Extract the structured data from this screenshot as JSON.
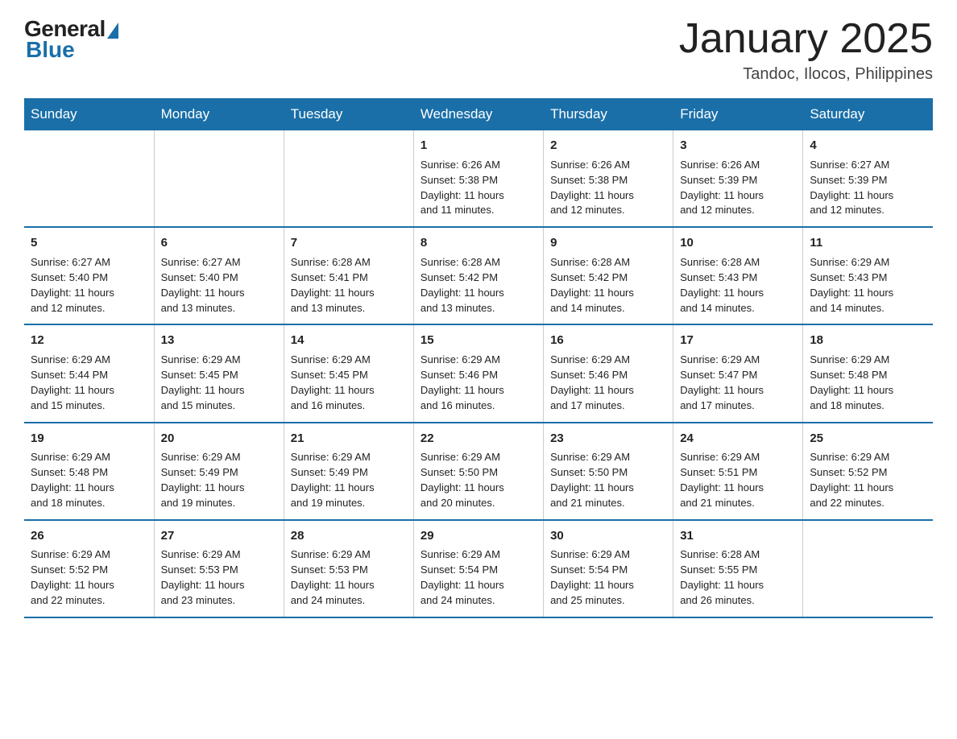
{
  "logo": {
    "general": "General",
    "blue": "Blue"
  },
  "header": {
    "title": "January 2025",
    "subtitle": "Tandoc, Ilocos, Philippines"
  },
  "weekdays": [
    "Sunday",
    "Monday",
    "Tuesday",
    "Wednesday",
    "Thursday",
    "Friday",
    "Saturday"
  ],
  "weeks": [
    [
      {
        "day": "",
        "info": ""
      },
      {
        "day": "",
        "info": ""
      },
      {
        "day": "",
        "info": ""
      },
      {
        "day": "1",
        "info": "Sunrise: 6:26 AM\nSunset: 5:38 PM\nDaylight: 11 hours\nand 11 minutes."
      },
      {
        "day": "2",
        "info": "Sunrise: 6:26 AM\nSunset: 5:38 PM\nDaylight: 11 hours\nand 12 minutes."
      },
      {
        "day": "3",
        "info": "Sunrise: 6:26 AM\nSunset: 5:39 PM\nDaylight: 11 hours\nand 12 minutes."
      },
      {
        "day": "4",
        "info": "Sunrise: 6:27 AM\nSunset: 5:39 PM\nDaylight: 11 hours\nand 12 minutes."
      }
    ],
    [
      {
        "day": "5",
        "info": "Sunrise: 6:27 AM\nSunset: 5:40 PM\nDaylight: 11 hours\nand 12 minutes."
      },
      {
        "day": "6",
        "info": "Sunrise: 6:27 AM\nSunset: 5:40 PM\nDaylight: 11 hours\nand 13 minutes."
      },
      {
        "day": "7",
        "info": "Sunrise: 6:28 AM\nSunset: 5:41 PM\nDaylight: 11 hours\nand 13 minutes."
      },
      {
        "day": "8",
        "info": "Sunrise: 6:28 AM\nSunset: 5:42 PM\nDaylight: 11 hours\nand 13 minutes."
      },
      {
        "day": "9",
        "info": "Sunrise: 6:28 AM\nSunset: 5:42 PM\nDaylight: 11 hours\nand 14 minutes."
      },
      {
        "day": "10",
        "info": "Sunrise: 6:28 AM\nSunset: 5:43 PM\nDaylight: 11 hours\nand 14 minutes."
      },
      {
        "day": "11",
        "info": "Sunrise: 6:29 AM\nSunset: 5:43 PM\nDaylight: 11 hours\nand 14 minutes."
      }
    ],
    [
      {
        "day": "12",
        "info": "Sunrise: 6:29 AM\nSunset: 5:44 PM\nDaylight: 11 hours\nand 15 minutes."
      },
      {
        "day": "13",
        "info": "Sunrise: 6:29 AM\nSunset: 5:45 PM\nDaylight: 11 hours\nand 15 minutes."
      },
      {
        "day": "14",
        "info": "Sunrise: 6:29 AM\nSunset: 5:45 PM\nDaylight: 11 hours\nand 16 minutes."
      },
      {
        "day": "15",
        "info": "Sunrise: 6:29 AM\nSunset: 5:46 PM\nDaylight: 11 hours\nand 16 minutes."
      },
      {
        "day": "16",
        "info": "Sunrise: 6:29 AM\nSunset: 5:46 PM\nDaylight: 11 hours\nand 17 minutes."
      },
      {
        "day": "17",
        "info": "Sunrise: 6:29 AM\nSunset: 5:47 PM\nDaylight: 11 hours\nand 17 minutes."
      },
      {
        "day": "18",
        "info": "Sunrise: 6:29 AM\nSunset: 5:48 PM\nDaylight: 11 hours\nand 18 minutes."
      }
    ],
    [
      {
        "day": "19",
        "info": "Sunrise: 6:29 AM\nSunset: 5:48 PM\nDaylight: 11 hours\nand 18 minutes."
      },
      {
        "day": "20",
        "info": "Sunrise: 6:29 AM\nSunset: 5:49 PM\nDaylight: 11 hours\nand 19 minutes."
      },
      {
        "day": "21",
        "info": "Sunrise: 6:29 AM\nSunset: 5:49 PM\nDaylight: 11 hours\nand 19 minutes."
      },
      {
        "day": "22",
        "info": "Sunrise: 6:29 AM\nSunset: 5:50 PM\nDaylight: 11 hours\nand 20 minutes."
      },
      {
        "day": "23",
        "info": "Sunrise: 6:29 AM\nSunset: 5:50 PM\nDaylight: 11 hours\nand 21 minutes."
      },
      {
        "day": "24",
        "info": "Sunrise: 6:29 AM\nSunset: 5:51 PM\nDaylight: 11 hours\nand 21 minutes."
      },
      {
        "day": "25",
        "info": "Sunrise: 6:29 AM\nSunset: 5:52 PM\nDaylight: 11 hours\nand 22 minutes."
      }
    ],
    [
      {
        "day": "26",
        "info": "Sunrise: 6:29 AM\nSunset: 5:52 PM\nDaylight: 11 hours\nand 22 minutes."
      },
      {
        "day": "27",
        "info": "Sunrise: 6:29 AM\nSunset: 5:53 PM\nDaylight: 11 hours\nand 23 minutes."
      },
      {
        "day": "28",
        "info": "Sunrise: 6:29 AM\nSunset: 5:53 PM\nDaylight: 11 hours\nand 24 minutes."
      },
      {
        "day": "29",
        "info": "Sunrise: 6:29 AM\nSunset: 5:54 PM\nDaylight: 11 hours\nand 24 minutes."
      },
      {
        "day": "30",
        "info": "Sunrise: 6:29 AM\nSunset: 5:54 PM\nDaylight: 11 hours\nand 25 minutes."
      },
      {
        "day": "31",
        "info": "Sunrise: 6:28 AM\nSunset: 5:55 PM\nDaylight: 11 hours\nand 26 minutes."
      },
      {
        "day": "",
        "info": ""
      }
    ]
  ],
  "colors": {
    "header_bg": "#1a6fa8",
    "border": "#1a6fa8",
    "text": "#222222"
  }
}
